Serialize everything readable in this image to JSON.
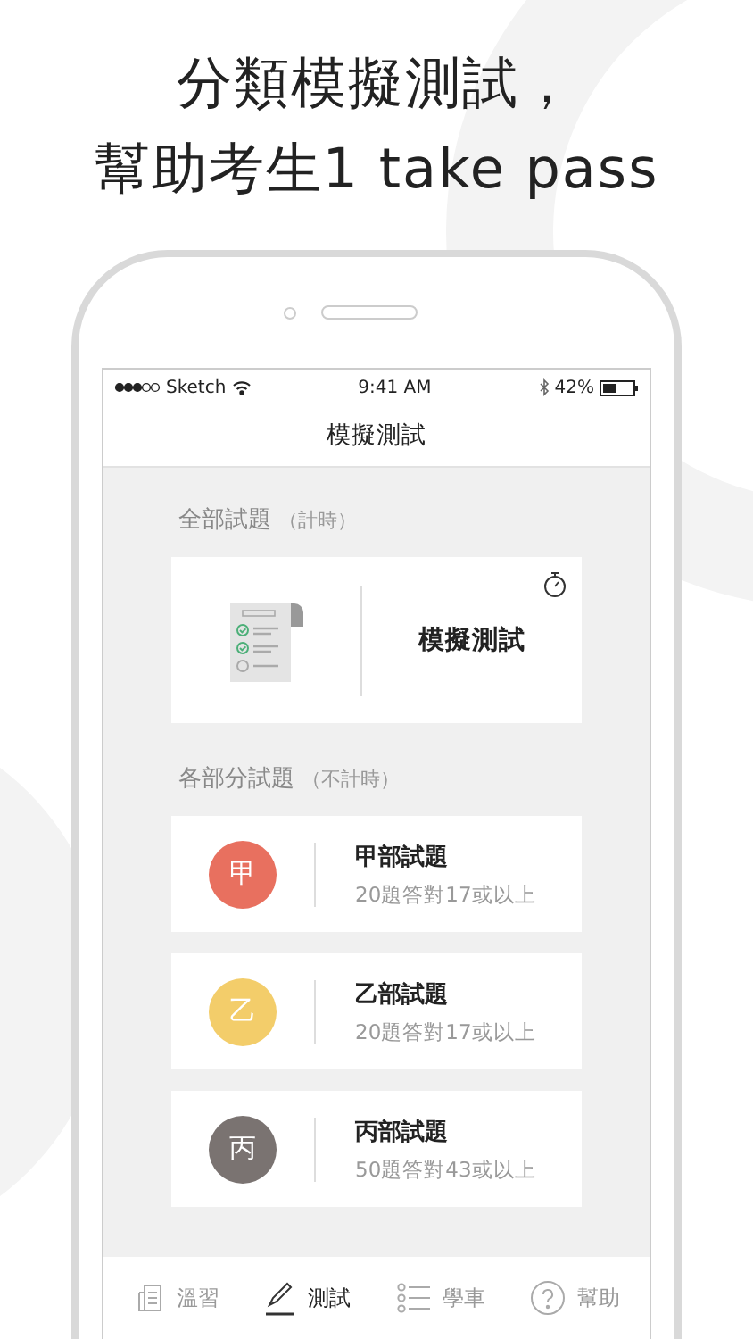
{
  "headline": [
    "分類模擬測試，",
    "幫助考生1 take pass"
  ],
  "status_bar": {
    "carrier": "Sketch",
    "time": "9:41 AM",
    "battery": "42%"
  },
  "nav_title": "模擬測試",
  "full_section": {
    "title": "全部試題",
    "note": "（計時）",
    "card_title": "模擬測試"
  },
  "parts_section": {
    "title": "各部分試題",
    "note": "（不計時）"
  },
  "parts": [
    {
      "badge": "甲",
      "title": "甲部試題",
      "subtitle": "20題答對17或以上",
      "color": "#e8705f"
    },
    {
      "badge": "乙",
      "title": "乙部試題",
      "subtitle": "20題答對17或以上",
      "color": "#f3cd6a"
    },
    {
      "badge": "丙",
      "title": "丙部試題",
      "subtitle": "50題答對43或以上",
      "color": "#7a7371"
    }
  ],
  "tabs": [
    {
      "kind": "review",
      "label": "溫習",
      "selected": false
    },
    {
      "kind": "test",
      "label": "測試",
      "selected": true
    },
    {
      "kind": "learn",
      "label": "學車",
      "selected": false
    },
    {
      "kind": "help",
      "label": "幫助",
      "selected": false
    }
  ]
}
